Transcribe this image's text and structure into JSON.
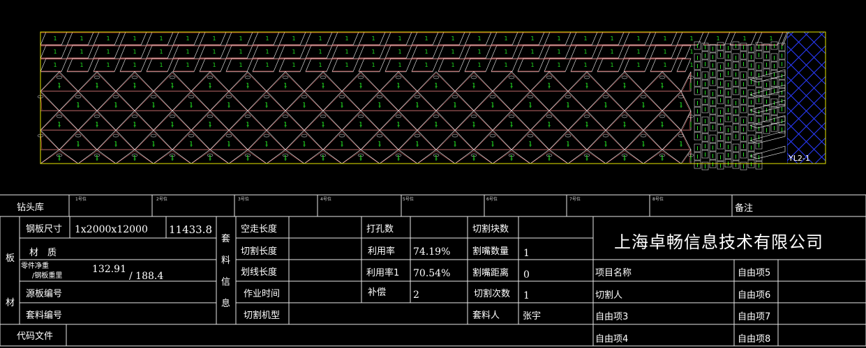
{
  "drawing": {
    "sheet_label": "YL2-1",
    "part_label": "1"
  },
  "title_block": {
    "drill_row": {
      "label": "钻头库",
      "slots": [
        "1号位",
        "2号位",
        "3号位",
        "4号位",
        "5号位",
        "6号位",
        "7号位",
        "8号位"
      ],
      "remark_label": "备注"
    },
    "plate_group_label": [
      "板",
      "材"
    ],
    "plate": {
      "size_label": "钢板尺寸",
      "size_value": "1x2000x12000",
      "size_extra": "11433.8",
      "material_label": "材　质",
      "weight_label_1": "零件净重",
      "weight_label_2": "/钢板重里",
      "weight_value_1": "132.91",
      "weight_value_2": "/ 188.4",
      "source_label": "源板编号",
      "nest_no_label": "套料编号"
    },
    "nest_group_label": [
      "套",
      "料",
      "信",
      "息"
    ],
    "nest": {
      "idle_length_label": "空走长度",
      "cut_length_label": "切割长度",
      "scribe_length_label": "划线长度",
      "work_time_label": "作业时间",
      "cut_machine_label": "切割机型",
      "punch_count_label": "打孔数",
      "util_label": "利用率",
      "util_value": "74.19%",
      "util1_label": "利用率1",
      "util1_value": "70.54%",
      "comp_label": "补偿",
      "comp_value": "2",
      "cut_pieces_label": "切割块数",
      "nozzle_count_label": "割嘴数量",
      "nozzle_count_value": "1",
      "nozzle_dist_label": "割嘴距离",
      "nozzle_dist_value": "0",
      "cut_times_label": "切割次数",
      "cut_times_value": "1",
      "nester_label": "套料人",
      "nester_value": "张宇"
    },
    "code_file_label": "代码文件",
    "company": "上海卓畅信息技术有限公司",
    "project": {
      "name_label": "项目名称",
      "cutter_label": "切割人",
      "free3": "自由项3",
      "free4": "自由项4",
      "free5": "自由项5",
      "free6": "自由项6",
      "free7": "自由项7",
      "free8": "自由项8"
    }
  }
}
